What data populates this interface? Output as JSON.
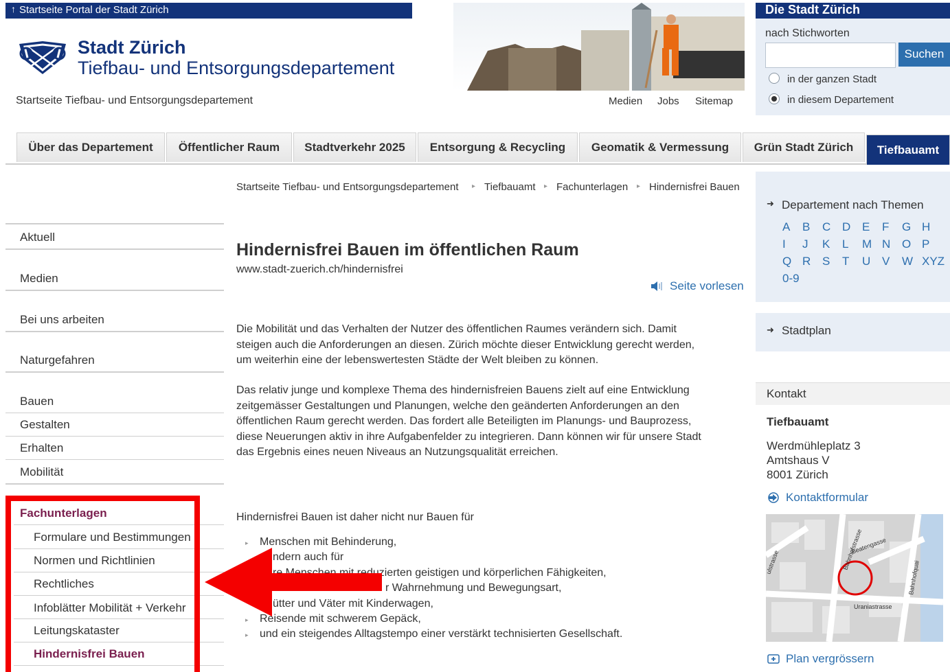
{
  "header": {
    "portal_link": "Startseite Portal der Stadt Zürich",
    "brand_name": "Stadt Zürich",
    "department": "Tiefbau- und Entsorgungsdepartement",
    "home_link": "Startseite Tiefbau- und Entsorgungsdepartement",
    "links": [
      "Medien",
      "Jobs",
      "Sitemap"
    ]
  },
  "search": {
    "title": "Die Stadt Zürich",
    "label": "nach Stichworten",
    "value": "",
    "button": "Suchen",
    "options": [
      {
        "label": "in der ganzen Stadt",
        "selected": false
      },
      {
        "label": "in diesem Departement",
        "selected": true
      }
    ]
  },
  "tabs": [
    {
      "label": "Über das Departement",
      "active": false
    },
    {
      "label": "Öffentlicher Raum",
      "active": false
    },
    {
      "label": "Stadtverkehr 2025",
      "active": false
    },
    {
      "label": "Entsorgung & Recycling",
      "active": false
    },
    {
      "label": "Geomatik & Vermessung",
      "active": false
    },
    {
      "label": "Grün Stadt Zürich",
      "active": false
    },
    {
      "label": "Tiefbauamt",
      "active": true
    }
  ],
  "breadcrumb": [
    "Startseite Tiefbau- und Entsorgungsdepartement",
    "Tiefbauamt",
    "Fachunterlagen",
    "Hindernisfrei Bauen"
  ],
  "nav": {
    "top": [
      "Aktuell",
      "Medien",
      "Bei uns arbeiten",
      "Naturgefahren"
    ],
    "group": [
      "Bauen",
      "Gestalten",
      "Erhalten",
      "Mobilität"
    ],
    "section": "Fachunterlagen",
    "sub": [
      "Formulare und Bestimmungen",
      "Normen und Richtlinien",
      "Rechtliches",
      "Infoblätter Mobilität + Verkehr",
      "Leitungskataster",
      "Hindernisfrei Bauen"
    ],
    "current": "Hindernisfrei Bauen"
  },
  "main": {
    "title": "Hindernisfrei Bauen im öffentlichen Raum",
    "url": "www.stadt-zuerich.ch/hindernisfrei",
    "read_aloud": "Seite vorlesen",
    "para1": [
      "Die Mobilität und das Verhalten der Nutzer des öffentlichen Raumes verändern sich. Damit",
      "steigen auch die Anforderungen an diesen. Zürich möchte dieser Entwicklung gerecht werden,",
      "um weiterhin eine der lebenswertesten Städte der Welt bleiben zu können."
    ],
    "para2": [
      "Das relativ junge und komplexe Thema des hindernisfreien Bauens zielt auf eine Entwicklung",
      "zeitgemässer Gestaltungen und Planungen, welche den geänderten Anforderungen an den",
      "öffentlichen Raum gerecht werden. Das fordert alle Beteiligten im Planungs- und Bauprozess,",
      "diese Neuerungen aktiv in ihre Aufgabenfelder zu integrieren. Dann können wir für unsere Stadt",
      "das Ergebnis eines neuen Niveaus an Nutzungsqualität erreichen."
    ],
    "intro": "Hindernisfrei Bauen ist daher nicht nur Bauen für",
    "bullets": [
      "Menschen mit Behinderung,",
      "ndern auch für",
      "re Menschen mit reduzierten geistigen und körperlichen Fähigkeiten,",
      "r Wahrnehmung und Bewegungsart,",
      "ütter und Väter mit Kinderwagen,",
      "Reisende mit schwerem Gepäck,",
      "und ein steigendes Alltagstempo einer verstärkt technisierten Gesellschaft."
    ]
  },
  "right": {
    "themes_link": "Departement nach Themen",
    "alphabet": [
      [
        "A",
        "B",
        "C",
        "D",
        "E",
        "F",
        "G",
        "H"
      ],
      [
        "I",
        "J",
        "K",
        "L",
        "M",
        "N",
        "O",
        "P"
      ],
      [
        "Q",
        "R",
        "S",
        "T",
        "U",
        "V",
        "W",
        "XYZ"
      ],
      [
        "0-9"
      ]
    ],
    "stadtplan": "Stadtplan",
    "contact_head": "Kontakt",
    "contact_name": "Tiefbauamt",
    "address": [
      "Werdmühleplatz 3",
      "Amtshaus V",
      "8001 Zürich"
    ],
    "contact_form": "Kontaktformular",
    "map_labels": [
      "Bahnhofstrasse",
      "Beatengasse",
      "Bahnhofquai",
      "Uraniastrasse",
      "ulstrasse"
    ],
    "enlarge_map": "Plan vergrössern"
  },
  "colors": {
    "brand": "#13337a",
    "link": "#2d6fae",
    "highlight": "#f40000",
    "nav_active": "#7a1f4e"
  }
}
